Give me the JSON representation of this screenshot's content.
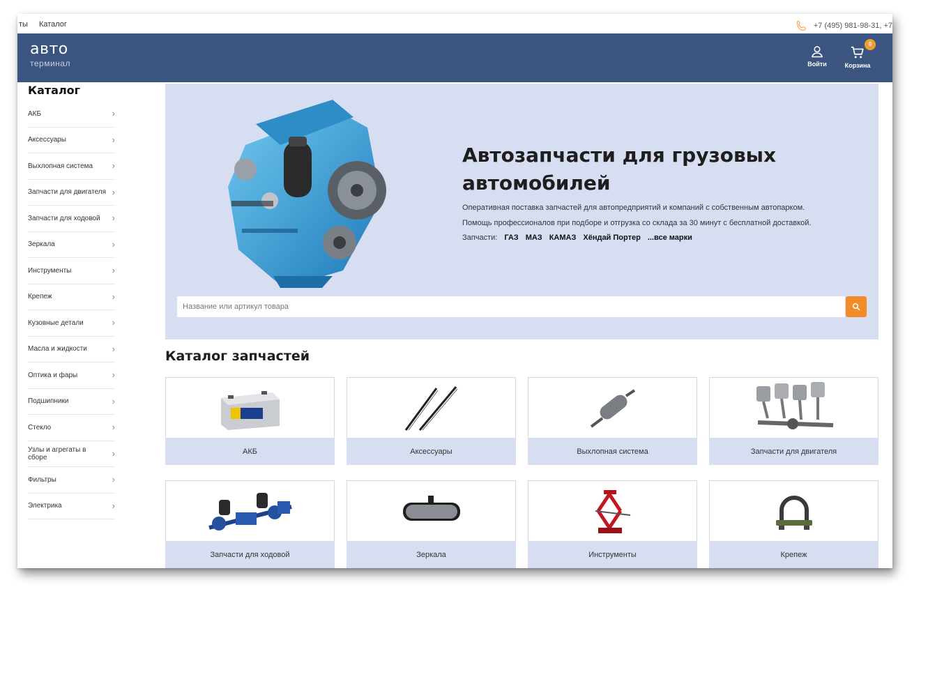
{
  "topbar": {
    "links": [
      "ты",
      "Каталог"
    ],
    "phone": "+7 (495) 981-98-31, +7"
  },
  "header": {
    "logo_main": "авто",
    "logo_sub": "терминал",
    "login_label": "Войти",
    "cart_label": "Корзина",
    "cart_count": "0",
    "bg_color": "#3b5580"
  },
  "sidebar": {
    "title": "Каталог",
    "items": [
      {
        "label": "АКБ"
      },
      {
        "label": "Аксессуары"
      },
      {
        "label": "Выхлопная система"
      },
      {
        "label": "Запчасти для двигателя"
      },
      {
        "label": "Запчасти для ходовой"
      },
      {
        "label": "Зеркала"
      },
      {
        "label": "Инструменты"
      },
      {
        "label": "Крепеж"
      },
      {
        "label": "Кузовные детали"
      },
      {
        "label": "Масла и жидкости"
      },
      {
        "label": "Оптика и фары"
      },
      {
        "label": "Подшипники"
      },
      {
        "label": "Стекло"
      },
      {
        "label": "Узлы и агрегаты в сборе"
      },
      {
        "label": "Фильтры"
      },
      {
        "label": "Электрика"
      }
    ]
  },
  "hero": {
    "title": "Автозапчасти для грузовых автомобилей",
    "line1": "Оперативная поставка запчастей для автопредприятий и компаний с собственным автопарком.",
    "line2": "Помощь профессионалов при подборе и отгрузка со склада за 30 минут с бесплатной доставкой.",
    "brands_label": "Запчасти:",
    "brands": [
      "ГАЗ",
      "МАЗ",
      "КАМАЗ",
      "Хёндай Портер",
      "...все марки"
    ],
    "bg_color": "#d8def2"
  },
  "search": {
    "placeholder": "Название или артикул товара",
    "button_color": "#f28c28"
  },
  "catalog": {
    "title": "Каталог запчастей",
    "cards": [
      {
        "label": "АКБ",
        "icon": "battery-icon"
      },
      {
        "label": "Аксессуары",
        "icon": "wiper-blades-icon"
      },
      {
        "label": "Выхлопная система",
        "icon": "muffler-icon"
      },
      {
        "label": "Запчасти для двигателя",
        "icon": "crankshaft-pistons-icon"
      },
      {
        "label": "Запчасти для ходовой",
        "icon": "axle-assembly-icon"
      },
      {
        "label": "Зеркала",
        "icon": "rearview-mirror-icon"
      },
      {
        "label": "Инструменты",
        "icon": "car-jack-icon"
      },
      {
        "label": "Крепеж",
        "icon": "clamp-icon"
      }
    ]
  }
}
